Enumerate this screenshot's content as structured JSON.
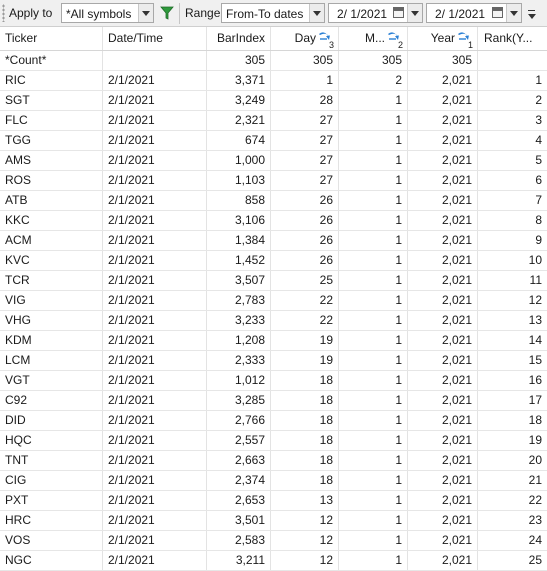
{
  "toolbar": {
    "apply_to_label": "Apply to",
    "apply_to_value": "*All symbols",
    "range_label": "Range",
    "range_value": "From-To dates",
    "from_date": "2/  1/2021",
    "to_date": "2/  1/2021"
  },
  "columns": [
    {
      "label": "Ticker"
    },
    {
      "label": "Date/Time"
    },
    {
      "label": "BarIndex"
    },
    {
      "label": "Day",
      "sort_rank": "3"
    },
    {
      "label": "M...",
      "sort_rank": "2"
    },
    {
      "label": "Year",
      "sort_rank": "1"
    },
    {
      "label": "Rank(Y..."
    }
  ],
  "count_row": [
    "*Count*",
    "",
    "305",
    "305",
    "305",
    "305",
    ""
  ],
  "rows": [
    [
      "RIC",
      "2/1/2021",
      "3,371",
      "1",
      "2",
      "2,021",
      "1"
    ],
    [
      "SGT",
      "2/1/2021",
      "3,249",
      "28",
      "1",
      "2,021",
      "2"
    ],
    [
      "FLC",
      "2/1/2021",
      "2,321",
      "27",
      "1",
      "2,021",
      "3"
    ],
    [
      "TGG",
      "2/1/2021",
      "674",
      "27",
      "1",
      "2,021",
      "4"
    ],
    [
      "AMS",
      "2/1/2021",
      "1,000",
      "27",
      "1",
      "2,021",
      "5"
    ],
    [
      "ROS",
      "2/1/2021",
      "1,103",
      "27",
      "1",
      "2,021",
      "6"
    ],
    [
      "ATB",
      "2/1/2021",
      "858",
      "26",
      "1",
      "2,021",
      "7"
    ],
    [
      "KKC",
      "2/1/2021",
      "3,106",
      "26",
      "1",
      "2,021",
      "8"
    ],
    [
      "ACM",
      "2/1/2021",
      "1,384",
      "26",
      "1",
      "2,021",
      "9"
    ],
    [
      "KVC",
      "2/1/2021",
      "1,452",
      "26",
      "1",
      "2,021",
      "10"
    ],
    [
      "TCR",
      "2/1/2021",
      "3,507",
      "25",
      "1",
      "2,021",
      "11"
    ],
    [
      "VIG",
      "2/1/2021",
      "2,783",
      "22",
      "1",
      "2,021",
      "12"
    ],
    [
      "VHG",
      "2/1/2021",
      "3,233",
      "22",
      "1",
      "2,021",
      "13"
    ],
    [
      "KDM",
      "2/1/2021",
      "1,208",
      "19",
      "1",
      "2,021",
      "14"
    ],
    [
      "LCM",
      "2/1/2021",
      "2,333",
      "19",
      "1",
      "2,021",
      "15"
    ],
    [
      "VGT",
      "2/1/2021",
      "1,012",
      "18",
      "1",
      "2,021",
      "16"
    ],
    [
      "C92",
      "2/1/2021",
      "3,285",
      "18",
      "1",
      "2,021",
      "17"
    ],
    [
      "DID",
      "2/1/2021",
      "2,766",
      "18",
      "1",
      "2,021",
      "18"
    ],
    [
      "HQC",
      "2/1/2021",
      "2,557",
      "18",
      "1",
      "2,021",
      "19"
    ],
    [
      "TNT",
      "2/1/2021",
      "2,663",
      "18",
      "1",
      "2,021",
      "20"
    ],
    [
      "CIG",
      "2/1/2021",
      "2,374",
      "18",
      "1",
      "2,021",
      "21"
    ],
    [
      "PXT",
      "2/1/2021",
      "2,653",
      "13",
      "1",
      "2,021",
      "22"
    ],
    [
      "HRC",
      "2/1/2021",
      "3,501",
      "12",
      "1",
      "2,021",
      "23"
    ],
    [
      "VOS",
      "2/1/2021",
      "2,583",
      "12",
      "1",
      "2,021",
      "24"
    ],
    [
      "NGC",
      "2/1/2021",
      "3,211",
      "12",
      "1",
      "2,021",
      "25"
    ]
  ],
  "icons": {
    "filter": "filter-funnel-icon",
    "sort": "sort-descending-icon",
    "calendar": "calendar-icon",
    "overflow": "toolbar-overflow-icon"
  },
  "colors": {
    "filter_green": "#2e9a3c",
    "sort_blue": "#2a7fd4",
    "toolbar_bg": "#f0f0f0"
  }
}
